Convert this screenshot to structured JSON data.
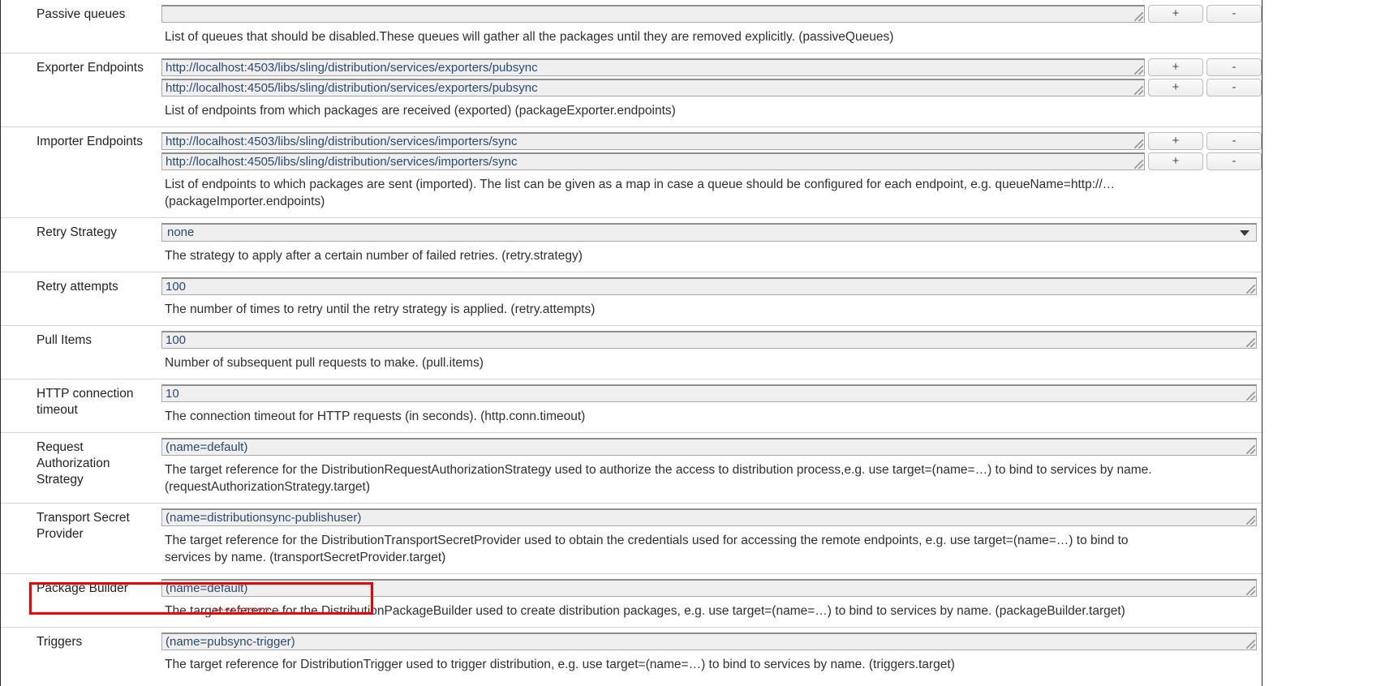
{
  "form": {
    "rows": [
      {
        "label": "Passive queues",
        "type": "list",
        "values": [
          ""
        ],
        "add_label": "+",
        "remove_label": "-",
        "description": "List of queues that should be disabled.These queues will gather all the packages until they are removed explicitly. (passiveQueues)"
      },
      {
        "label": "Exporter Endpoints",
        "type": "list",
        "values": [
          "http://localhost:4503/libs/sling/distribution/services/exporters/pubsync",
          "http://localhost:4505/libs/sling/distribution/services/exporters/pubsync"
        ],
        "add_label": "+",
        "remove_label": "-",
        "description": "List of endpoints from which packages are received (exported) (packageExporter.endpoints)"
      },
      {
        "label": "Importer Endpoints",
        "type": "list",
        "values": [
          "http://localhost:4503/libs/sling/distribution/services/importers/sync",
          "http://localhost:4505/libs/sling/distribution/services/importers/sync"
        ],
        "add_label": "+",
        "remove_label": "-",
        "description": "List of endpoints to which packages are sent (imported). The list can be given as a map in case a queue should be configured for each endpoint, e.g. queueName=http://…",
        "description2": "(packageImporter.endpoints)"
      },
      {
        "label": "Retry Strategy",
        "type": "select",
        "value": "none",
        "options": [
          "none"
        ],
        "description": "The strategy to apply after a certain number of failed retries. (retry.strategy)"
      },
      {
        "label": "Retry attempts",
        "type": "text",
        "value": "100",
        "description": "The number of times to retry until the retry strategy is applied. (retry.attempts)"
      },
      {
        "label": "Pull Items",
        "type": "text",
        "value": "100",
        "description": "Number of subsequent pull requests to make. (pull.items)"
      },
      {
        "label": "HTTP connection timeout",
        "type": "text",
        "value": "10",
        "description": "The connection timeout for HTTP requests (in seconds). (http.conn.timeout)"
      },
      {
        "label": "Request Authorization Strategy",
        "type": "text",
        "value": "(name=default)",
        "description": "The target reference for the DistributionRequestAuthorizationStrategy used to authorize the access to distribution process,e.g. use target=(name=…) to bind to services by name.",
        "description2": "(requestAuthorizationStrategy.target)"
      },
      {
        "label": "Transport Secret Provider",
        "type": "text",
        "value": "(name=distributionsync-publishuser)",
        "description": "The target reference for the DistributionTransportSecretProvider used to obtain the credentials used for accessing the remote endpoints, e.g. use target=(name=…) to bind to",
        "description2": "services by name. (transportSecretProvider.target)"
      },
      {
        "label": "Package Builder",
        "type": "text",
        "value": "(name=default)",
        "description": "The target reference for the DistributionPackageBuilder used to create distribution packages, e.g. use target=(name=…) to bind to services by name. (packageBuilder.target)"
      },
      {
        "label": "Triggers",
        "type": "text",
        "value": "(name=pubsync-trigger)",
        "highlighted": true,
        "misspelled_word": "pubsync",
        "description": "The target reference for DistributionTrigger used to trigger distribution, e.g. use target=(name=…) to bind to services by name. (triggers.target)"
      }
    ]
  },
  "colors": {
    "annotation": "#ee0000",
    "field_text": "#2b4a72",
    "field_bg": "#efefef",
    "spellcheck": "#ee2222"
  }
}
